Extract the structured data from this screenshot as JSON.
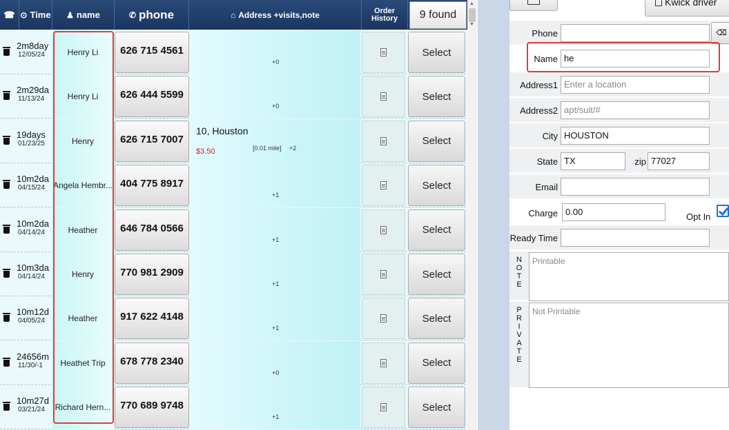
{
  "header": {
    "time_label": "Time",
    "name_label": "name",
    "phone_label": "phone",
    "address_label": "Address +visits,note",
    "order_history_line1": "Order",
    "order_history_line2": "History",
    "found_label": "9 found"
  },
  "rows": [
    {
      "duration": "2m8day",
      "date": "12/05/24",
      "name": "Henry Li",
      "phone": "626 715 4561",
      "address": "",
      "price": "",
      "distance": "",
      "visits": "+0",
      "select": "Select"
    },
    {
      "duration": "2m29da",
      "date": "11/13/24",
      "name": "Henry Li",
      "phone": "626 444 5599",
      "address": "",
      "price": "",
      "distance": "",
      "visits": "+0",
      "select": "Select"
    },
    {
      "duration": "19days",
      "date": "01/23/25",
      "name": "Henry",
      "phone": "626 715 7007",
      "address": "10, Houston",
      "price": "$3.50",
      "distance": "[0.01 mile]",
      "visits": "+2",
      "select": "Select"
    },
    {
      "duration": "10m2da",
      "date": "04/15/24",
      "name": "Angela Hembr...",
      "phone": "404 775 8917",
      "address": "",
      "price": "",
      "distance": "",
      "visits": "+1",
      "select": "Select"
    },
    {
      "duration": "10m2da",
      "date": "04/14/24",
      "name": "Heather",
      "phone": "646 784 0566",
      "address": "",
      "price": "",
      "distance": "",
      "visits": "+1",
      "select": "Select"
    },
    {
      "duration": "10m3da",
      "date": "04/14/24",
      "name": "Henry",
      "phone": "770 981 2909",
      "address": "",
      "price": "",
      "distance": "",
      "visits": "+1",
      "select": "Select"
    },
    {
      "duration": "10m12d",
      "date": "04/05/24",
      "name": "Heather",
      "phone": "917 622 4148",
      "address": "",
      "price": "",
      "distance": "",
      "visits": "+1",
      "select": "Select"
    },
    {
      "duration": "24656m",
      "date": "11/30/-1",
      "name": "Heathet Trip",
      "phone": "678 778 2340",
      "address": "",
      "price": "",
      "distance": "",
      "visits": "+0",
      "select": "Select"
    },
    {
      "duration": "10m27d",
      "date": "03/21/24",
      "name": "Richard Hern...",
      "phone": "770 689 9748",
      "address": "",
      "price": "",
      "distance": "",
      "visits": "+1",
      "select": "Select"
    }
  ],
  "form": {
    "kwick_driver_label": "Kwick driver",
    "phone": {
      "label": "Phone",
      "value": ""
    },
    "name": {
      "label": "Name",
      "value": "he"
    },
    "address1": {
      "label": "Address1",
      "placeholder": "Enter a location"
    },
    "address2": {
      "label": "Address2",
      "placeholder": "apt/suit/#"
    },
    "city": {
      "label": "City",
      "value": "HOUSTON"
    },
    "state": {
      "label": "State",
      "value": "TX"
    },
    "zip": {
      "label": "zip",
      "value": "77027"
    },
    "email": {
      "label": "Email",
      "value": ""
    },
    "charge": {
      "label": "Charge",
      "value": "0.00"
    },
    "opt_in_label": "Opt In",
    "ready_time": {
      "label": "Ready Time",
      "value": ""
    },
    "note_label": [
      "N",
      "O",
      "T",
      "E"
    ],
    "note_placeholder": "Printable",
    "private_label": [
      "P",
      "R",
      "I",
      "V",
      "A",
      "T",
      "E"
    ],
    "private_placeholder": "Not Printable"
  }
}
